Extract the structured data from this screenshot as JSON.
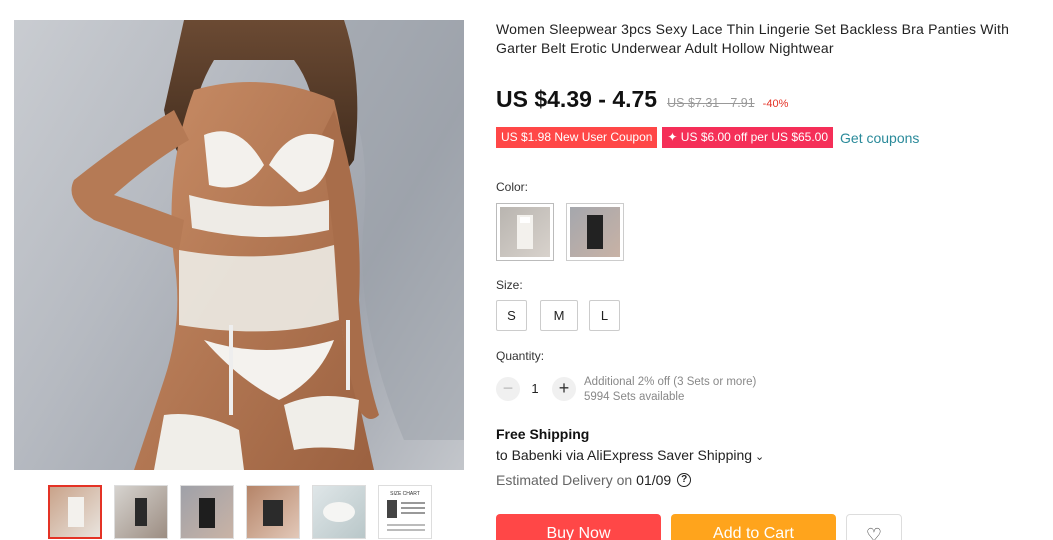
{
  "product": {
    "title": "Women Sleepwear 3pcs Sexy Lace Thin Lingerie Set Backless Bra Panties With Garter Belt Erotic Underwear Adult Hollow Nightwear",
    "price": "US $4.39 - 4.75",
    "old_price": "US $7.31 - 7.91",
    "discount": "-40%"
  },
  "coupons": {
    "new_user": "US $1.98 New User Coupon",
    "off_per": "✦ US $6.00 off per US $65.00",
    "get_link": "Get coupons"
  },
  "color": {
    "label": "Color:",
    "options": [
      "white",
      "black"
    ]
  },
  "size": {
    "label": "Size:",
    "options": [
      "S",
      "M",
      "L"
    ]
  },
  "quantity": {
    "label": "Quantity:",
    "minus": "−",
    "value": "1",
    "plus": "+",
    "discount_note": "Additional 2% off (3 Sets or more)",
    "available": "5994 Sets available"
  },
  "shipping": {
    "title": "Free Shipping",
    "line": "to Babenki via AliExpress Saver Shipping",
    "chevron": "⌄",
    "delivery_label": "Estimated Delivery on",
    "delivery_date": "01/09",
    "help": "?"
  },
  "actions": {
    "buy": "Buy Now",
    "cart": "Add to Cart",
    "wish": "♡"
  },
  "colors": {
    "accent_red": "#ff4747",
    "coupon_pink": "#f52f58",
    "cart_orange": "#ffa41c",
    "link_teal": "#2a8a9a"
  },
  "gallery": {
    "thumbnail_count": 6,
    "active_index": 0,
    "size_chart_label": "SIZE CHART"
  }
}
